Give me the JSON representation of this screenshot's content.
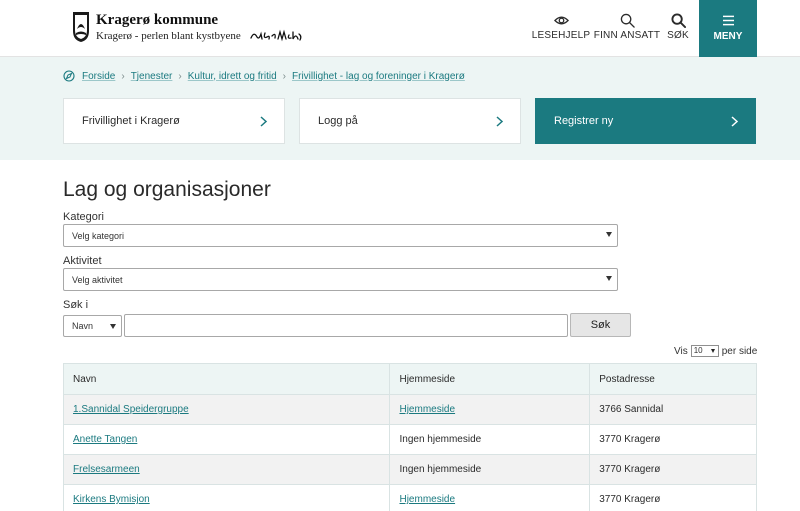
{
  "brand": {
    "title": "Kragerø kommune",
    "tagline": "Kragerø - perlen blant kystbyene",
    "signature": "Edvard Munch"
  },
  "nav": {
    "lesehjelp": "LESEHJELP",
    "finn_ansatt": "FINN ANSATT",
    "sok": "SØK",
    "meny": "MENY"
  },
  "breadcrumb": [
    "Forside",
    "Tjenester",
    "Kultur, idrett og fritid",
    "Frivillighet - lag og foreninger i Kragerø"
  ],
  "cards": [
    {
      "label": "Frivillighet i Kragerø"
    },
    {
      "label": "Logg på"
    },
    {
      "label": "Registrer ny"
    }
  ],
  "page_title": "Lag og organisasjoner",
  "form": {
    "kategori_label": "Kategori",
    "kategori_value": "Velg kategori",
    "aktivitet_label": "Aktivitet",
    "aktivitet_value": "Velg aktivitet",
    "sok_label": "Søk i",
    "sok_field_value": "Navn",
    "search_value": "",
    "search_button": "Søk"
  },
  "per_page": {
    "prefix": "Vis",
    "value": "10",
    "suffix": "per side"
  },
  "table": {
    "headers": [
      "Navn",
      "Hjemmeside",
      "Postadresse"
    ],
    "rows": [
      {
        "navn": "1.Sannidal Speidergruppe",
        "hjemmeside": "Hjemmeside",
        "has_link": true,
        "postadresse": "3766 Sannidal"
      },
      {
        "navn": "Anette Tangen",
        "hjemmeside": "Ingen hjemmeside",
        "has_link": false,
        "postadresse": "3770 Kragerø"
      },
      {
        "navn": "Frelsesarmeen",
        "hjemmeside": "Ingen hjemmeside",
        "has_link": false,
        "postadresse": "3770 Kragerø"
      },
      {
        "navn": "Kirkens Bymisjon",
        "hjemmeside": "Hjemmeside",
        "has_link": true,
        "postadresse": "3770 Kragerø"
      }
    ]
  },
  "colors": {
    "accent": "#1b7a80",
    "band": "#edf5f4"
  },
  "icons": {
    "logo": "coat-of-arms-icon",
    "lesehjelp": "eye-icon",
    "finn_ansatt": "search-icon",
    "sok": "search-icon",
    "meny": "hamburger-icon",
    "breadcrumb_home": "compass-icon",
    "card_arrow": "chevron-right-icon"
  }
}
